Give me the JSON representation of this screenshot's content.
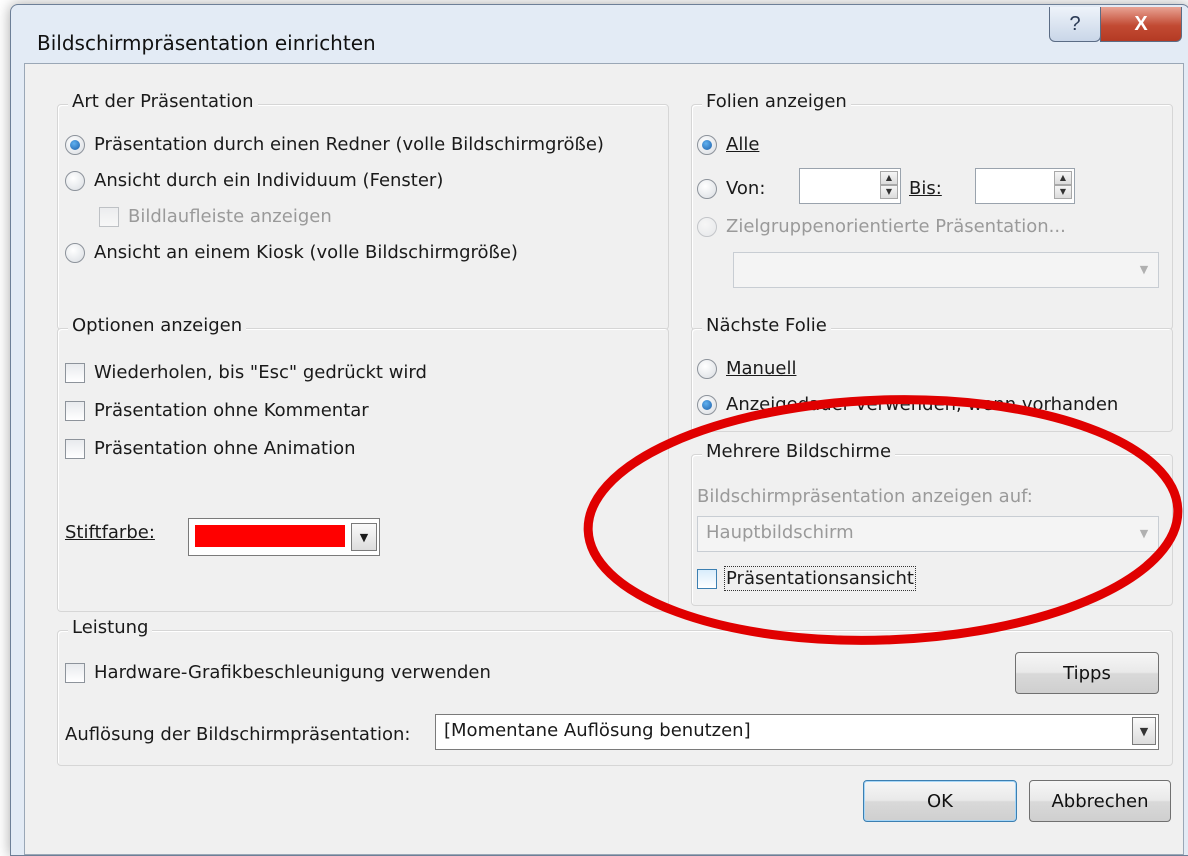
{
  "window": {
    "title": "Bildschirmpräsentation einrichten",
    "help_button": "?",
    "close_button": "X"
  },
  "art": {
    "legend": "Art der Präsentation",
    "opt_redner": "Präsentation durch einen Redner (volle Bildschirmgröße)",
    "opt_individuum": "Ansicht durch ein Individuum (Fenster)",
    "bildlauf": "Bildlaufleiste anzeigen",
    "opt_kiosk": "Ansicht an einem Kiosk (volle Bildschirmgröße)"
  },
  "folien": {
    "legend": "Folien anzeigen",
    "alle": "Alle",
    "von": "Von:",
    "bis": "Bis:",
    "von_value": "",
    "bis_value": "",
    "zielgruppe": "Zielgruppenorientierte Präsentation...",
    "zielgruppe_value": ""
  },
  "optionen": {
    "legend": "Optionen anzeigen",
    "wiederholen": "Wiederholen, bis \"Esc\" gedrückt wird",
    "ohne_kommentar": "Präsentation ohne Kommentar",
    "ohne_animation": "Präsentation ohne Animation",
    "stiftfarbe": "Stiftfarbe:"
  },
  "naechste": {
    "legend": "Nächste Folie",
    "manuell": "Manuell",
    "anzeigedauer": "Anzeigedauer verwenden, wenn vorhanden"
  },
  "mehrere": {
    "legend": "Mehrere Bildschirme",
    "anzeigen_auf": "Bildschirmpräsentation anzeigen auf:",
    "monitor_value": "Hauptbildschirm",
    "praesentationsansicht": "Präsentationsansicht"
  },
  "leistung": {
    "legend": "Leistung",
    "hardware": "Hardware-Grafikbeschleunigung verwenden",
    "tipps": "Tipps",
    "aufloesung_label": "Auflösung der Bildschirmpräsentation:",
    "aufloesung_value": "[Momentane Auflösung benutzen]"
  },
  "buttons": {
    "ok": "OK",
    "abbrechen": "Abbrechen"
  },
  "colors": {
    "pen_color": "#ff0000",
    "annotation": "#e00000"
  }
}
